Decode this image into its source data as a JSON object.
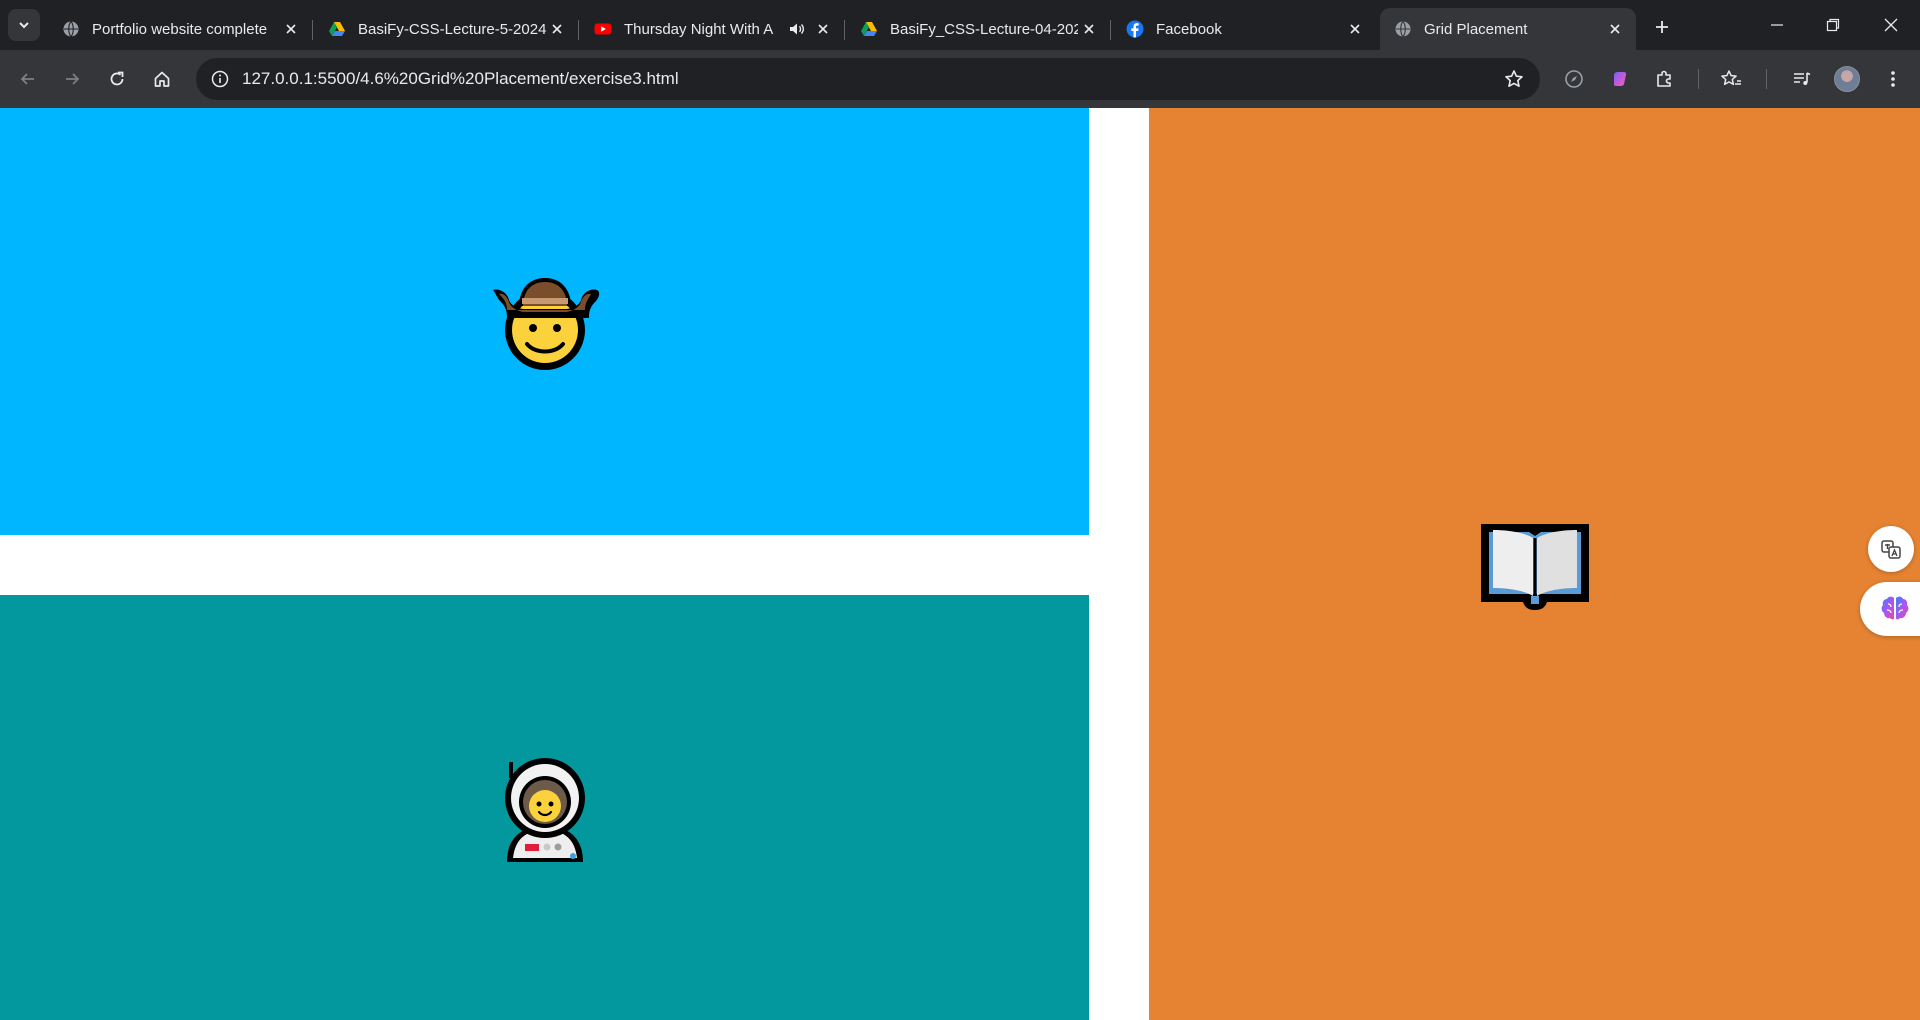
{
  "tabs": [
    {
      "title": "Portfolio website complete",
      "favicon": "globe-icon",
      "active": false
    },
    {
      "title": "BasiFy-CSS-Lecture-5-2024",
      "favicon": "google-drive-icon",
      "active": false
    },
    {
      "title": "Thursday Night With A",
      "favicon": "youtube-icon",
      "active": false,
      "audio": true
    },
    {
      "title": "BasiFy_CSS-Lecture-04-202",
      "favicon": "google-drive-icon",
      "active": false
    },
    {
      "title": "Facebook",
      "favicon": "facebook-icon",
      "active": false
    },
    {
      "title": "Grid Placement",
      "favicon": "globe-icon",
      "active": true
    }
  ],
  "address_bar": {
    "url": "127.0.0.1:5500/4.6%20Grid%20Placement/exercise3.html"
  },
  "page": {
    "items": [
      {
        "name": "cowboy",
        "emoji": "cowboy-hat-face",
        "background": "#00b7ff"
      },
      {
        "name": "astronaut",
        "emoji": "astronaut",
        "background": "#03989e"
      },
      {
        "name": "book",
        "emoji": "open-book",
        "background": "#e58332"
      }
    ]
  },
  "colors": {
    "tabstrip": "#202124",
    "toolbar": "#35363a",
    "page_background": "#ffffff"
  }
}
